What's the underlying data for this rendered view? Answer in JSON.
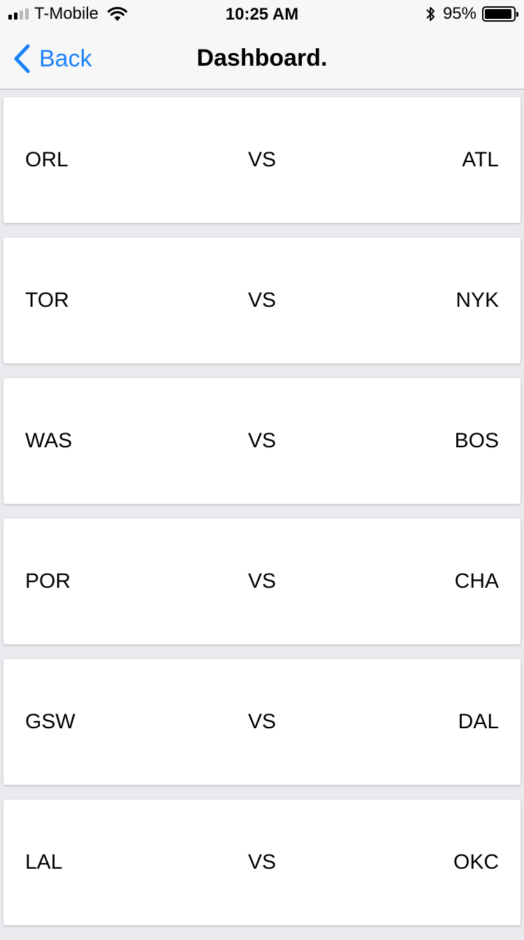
{
  "status_bar": {
    "carrier": "T-Mobile",
    "time": "10:25 AM",
    "battery_percent": "95%",
    "battery_level": 0.95,
    "signal_bars_filled": 2,
    "signal_bars_total": 4,
    "icons": [
      "signal-icon",
      "wifi-icon",
      "bluetooth-icon",
      "battery-icon"
    ]
  },
  "nav": {
    "back_label": "Back",
    "title": "Dashboard.",
    "accent_color": "#1a82fb"
  },
  "games": [
    {
      "home": "ORL",
      "vs": "VS",
      "away": "ATL"
    },
    {
      "home": "TOR",
      "vs": "VS",
      "away": "NYK"
    },
    {
      "home": "WAS",
      "vs": "VS",
      "away": "BOS"
    },
    {
      "home": "POR",
      "vs": "VS",
      "away": "CHA"
    },
    {
      "home": "GSW",
      "vs": "VS",
      "away": "DAL"
    },
    {
      "home": "LAL",
      "vs": "VS",
      "away": "OKC"
    }
  ]
}
